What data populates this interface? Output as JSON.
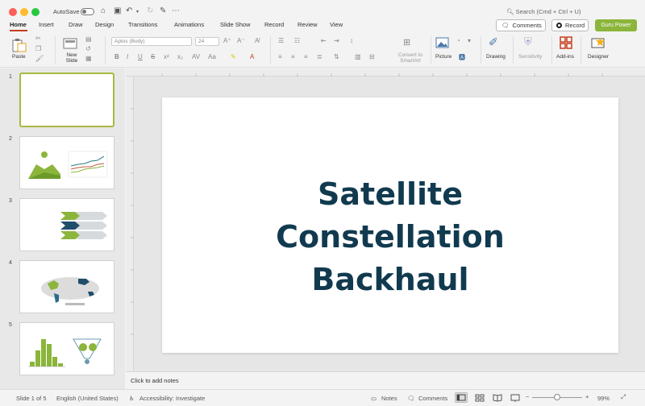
{
  "titlebar": {
    "autosave_label": "AutoSave",
    "search_placeholder": "Search (Cmd + Ctrl + U)"
  },
  "tabs": [
    "Home",
    "Insert",
    "Draw",
    "Design",
    "Transitions",
    "Animations",
    "Slide Show",
    "Record",
    "Review",
    "View"
  ],
  "header_buttons": {
    "comments": "Comments",
    "record": "Record",
    "guru": "Guru Power"
  },
  "ribbon": {
    "paste": "Paste",
    "new_slide": "New Slide",
    "font_name": "Aptos (Body)",
    "font_size": "24",
    "convert_smartart": "Convert to SmartArt",
    "picture": "Picture",
    "drawing": "Drawing",
    "sensitivity": "Sensitivity",
    "add_ins": "Add-ins",
    "designer": "Designer"
  },
  "thumbnails": [
    {
      "num": "1"
    },
    {
      "num": "2"
    },
    {
      "num": "3"
    },
    {
      "num": "4"
    },
    {
      "num": "5"
    }
  ],
  "slide": {
    "title": "Satellite\nConstellation\nBackhaul",
    "title_color": "#113a4f"
  },
  "notes_placeholder": "Click to add notes",
  "status": {
    "slide_of": "Slide 1 of 5",
    "language": "English (United States)",
    "accessibility": "Accessibility: Investigate",
    "notes": "Notes",
    "comments": "Comments",
    "zoom": "99%"
  },
  "colors": {
    "accent_green": "#8bb53b",
    "thumb_border": "#a9b93f",
    "tab_underline": "#c43e1c"
  }
}
